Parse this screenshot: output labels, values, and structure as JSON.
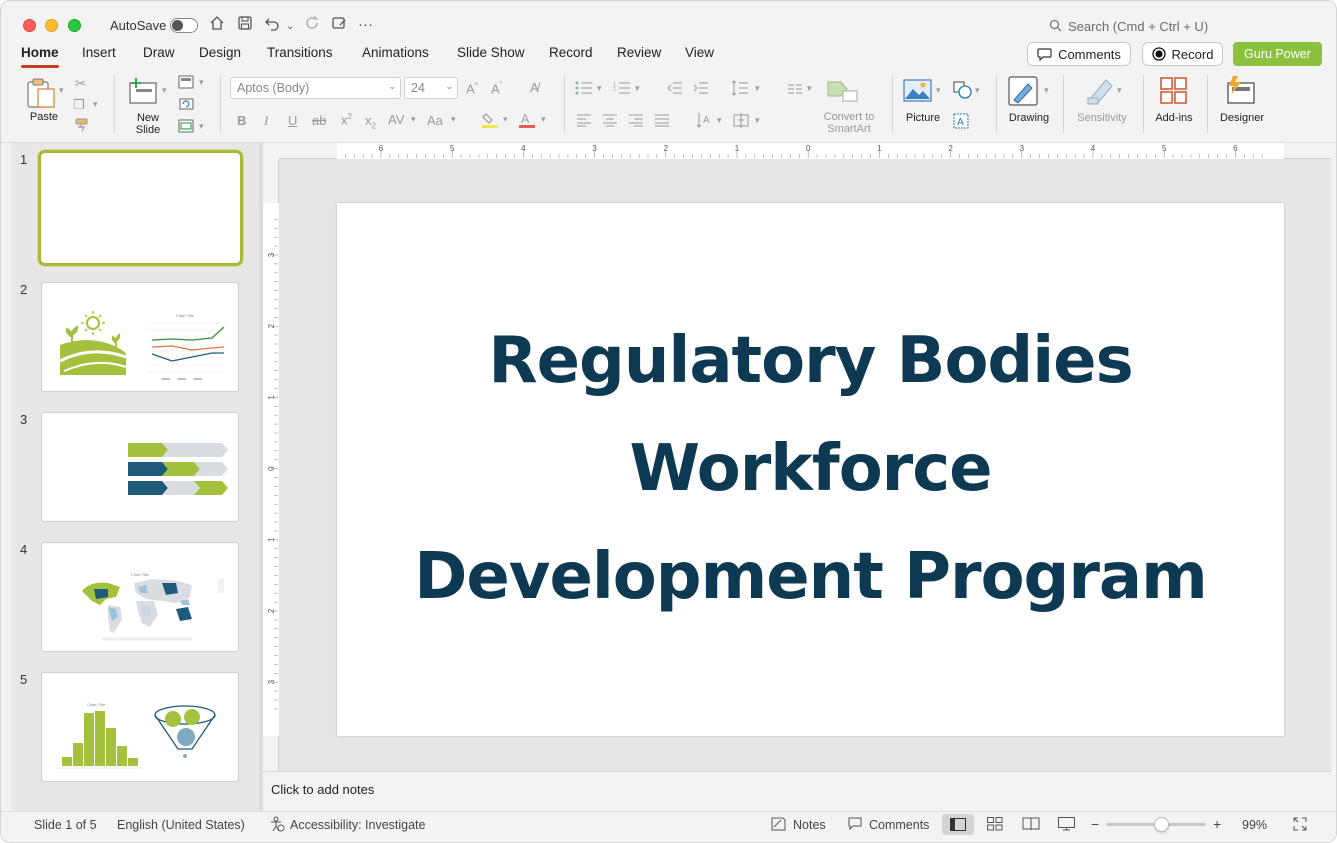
{
  "titlebar": {
    "autosave_label": "AutoSave",
    "search_placeholder": "Search (Cmd + Ctrl + U)"
  },
  "tabs": [
    "Home",
    "Insert",
    "Draw",
    "Design",
    "Transitions",
    "Animations",
    "Slide Show",
    "Record",
    "Review",
    "View"
  ],
  "active_tab": "Home",
  "top_right": {
    "comments_label": "Comments",
    "record_label": "Record",
    "guru_label": "Guru Power"
  },
  "ribbon": {
    "paste_label": "Paste",
    "new_slide_label": "New\nSlide",
    "font_name": "Aptos (Body)",
    "font_size": "24",
    "convert_smartart_label": "Convert to\nSmartArt",
    "picture_label": "Picture",
    "drawing_label": "Drawing",
    "sensitivity_label": "Sensitivity",
    "addins_label": "Add-ins",
    "designer_label": "Designer"
  },
  "slides": [
    {
      "number": "1"
    },
    {
      "number": "2",
      "chart_title": "Chart Title"
    },
    {
      "number": "3"
    },
    {
      "number": "4",
      "chart_title": "Chart Title"
    },
    {
      "number": "5",
      "chart_title": "Chart Title"
    }
  ],
  "ruler": {
    "h_ticks": [
      "6",
      "5",
      "4",
      "3",
      "2",
      "1",
      "0",
      "1",
      "2",
      "3",
      "4",
      "5",
      "6"
    ],
    "v_ticks": [
      "3",
      "2",
      "1",
      "0",
      "1",
      "2",
      "3"
    ]
  },
  "slide_content": {
    "title_lines": [
      "Regulatory Bodies",
      "Workforce",
      "Development Program"
    ]
  },
  "notes_placeholder": "Click to add notes",
  "status": {
    "slide_info": "Slide 1 of 5",
    "language": "English (United States)",
    "accessibility": "Accessibility: Investigate",
    "notes_label": "Notes",
    "comments_label": "Comments",
    "zoom": "99%",
    "zoom_level": 0.55
  },
  "colors": {
    "title_text": "#0d3a52",
    "accent_green": "#a3c13c",
    "accent_navy": "#1f5a7a",
    "active_tab_underline": "#c43e1c",
    "guru_button": "#8bc13c"
  }
}
